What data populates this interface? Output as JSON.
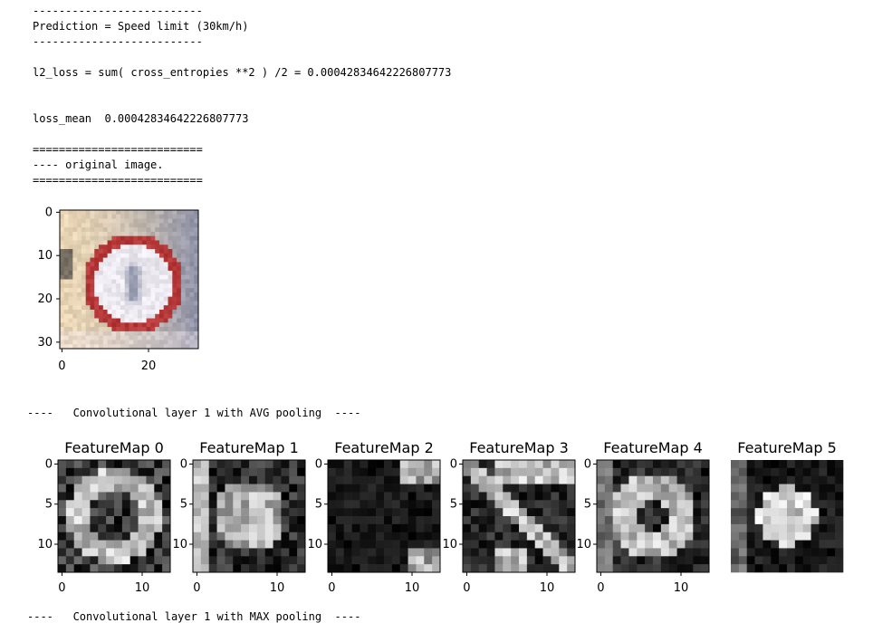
{
  "output": {
    "sep_short_1": "--------------------------",
    "prediction": "Prediction = Speed limit (30km/h)",
    "sep_short_2": "--------------------------",
    "l2_loss": "l2_loss = sum( cross_entropies **2 ) /2 = 0.00042834642226807773",
    "loss_mean": "loss_mean  0.00042834642226807773",
    "sep_eq_1": "==========================",
    "original_header": "---- original image.",
    "sep_eq_2": "==========================",
    "conv_header": "----   Convolutional layer 1 with AVG pooling  ----",
    "next_header_partial": "----   Convolutional layer 1 with MAX pooling  ----"
  },
  "original_image": {
    "yticks": [
      "0",
      "10",
      "20",
      "30"
    ],
    "xticks": [
      "0",
      "20"
    ],
    "colors": {
      "background_left": "#e9d6b6",
      "sign_ring": "#b73a3a",
      "sign_face": "#ebe8f0",
      "sign_center": "#6e7690",
      "right_background": "#8c90a8"
    }
  },
  "feature_maps": {
    "titles": [
      "FeatureMap 0",
      "FeatureMap 1",
      "FeatureMap 2",
      "FeatureMap 3",
      "FeatureMap 4",
      "FeatureMap 5"
    ],
    "yticks": [
      "0",
      "5",
      "10"
    ],
    "xticks": [
      "0",
      "10"
    ],
    "colormap": "gray"
  }
}
